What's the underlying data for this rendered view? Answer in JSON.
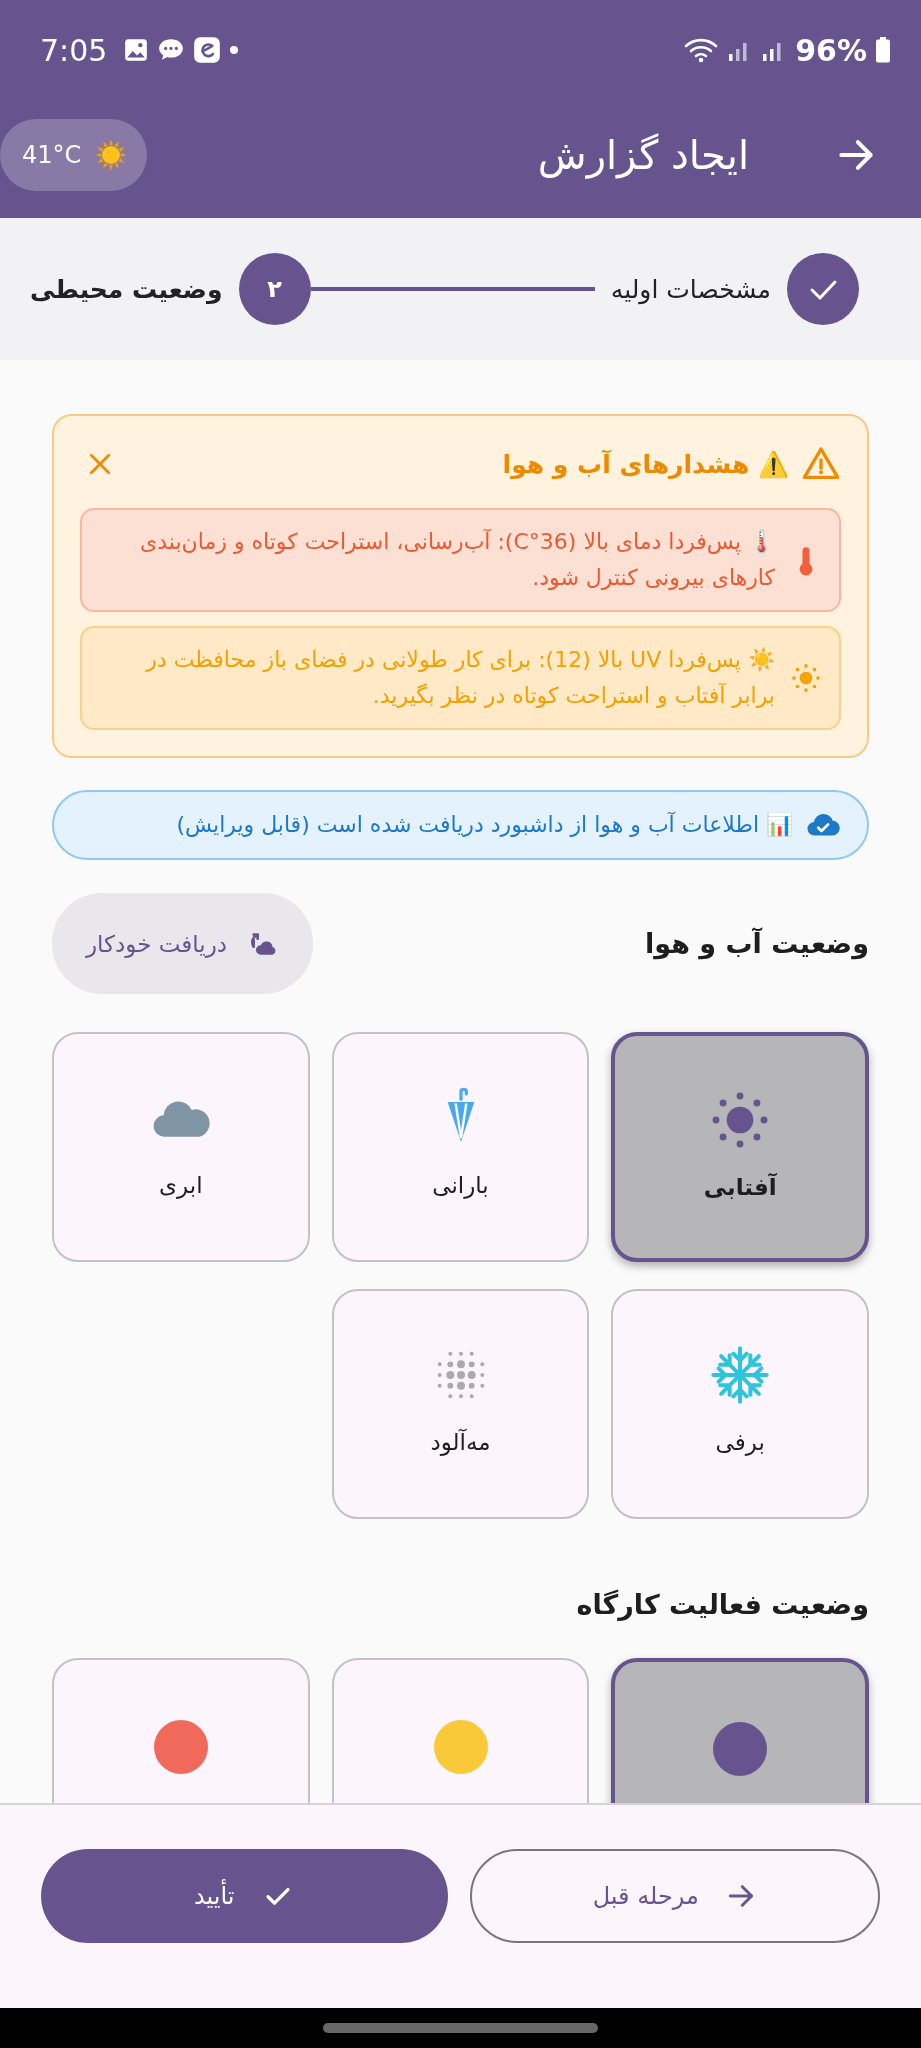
{
  "status_bar": {
    "time": "7:05",
    "battery": "96%"
  },
  "app_bar": {
    "title": "ایجاد گزارش",
    "weather_chip": {
      "temperature": "41°C"
    }
  },
  "stepper": {
    "steps": [
      {
        "label": "مشخصات اولیه",
        "done": true,
        "selected": false
      },
      {
        "label": "وضعیت محیطی",
        "number": "۲",
        "done": false,
        "selected": true
      }
    ]
  },
  "weather_alerts": {
    "title": "⚠️ هشدارهای آب و هوا",
    "alerts": [
      {
        "kind": "heat",
        "text": "🌡️ پس‌فردا دمای بالا (36°C): آب‌رسانی، استراحت کوتاه و زمان‌بندی کارهای بیرونی کنترل شود."
      },
      {
        "kind": "uv",
        "text": "☀️ پس‌فردا UV بالا (12): برای کار طولانی در فضای باز محافظت در برابر آفتاب و استراحت کوتاه در نظر بگیرید."
      }
    ]
  },
  "info_banner": {
    "text": "📊 اطلاعات آب و هوا از داشبورد دریافت شده است (قابل ویرایش)"
  },
  "weather_section": {
    "title": "وضعیت آب و هوا",
    "auto_fetch_button": "دریافت خودکار",
    "options": [
      {
        "kind": "sunny",
        "label": "آفتابی",
        "selected": true
      },
      {
        "kind": "rainy",
        "label": "بارانی",
        "selected": false
      },
      {
        "kind": "cloudy",
        "label": "ابری",
        "selected": false
      },
      {
        "kind": "snowy",
        "label": "برفی",
        "selected": false
      },
      {
        "kind": "foggy",
        "label": "مه‌آلود",
        "selected": false
      }
    ]
  },
  "activity_section": {
    "title": "وضعیت فعالیت کارگاه",
    "options": [
      {
        "selected": true,
        "color": "#67548e"
      },
      {
        "selected": false,
        "color": "#f9c93a"
      },
      {
        "selected": false,
        "color": "#f0695a"
      }
    ]
  },
  "footer": {
    "back_button": "مرحله قبل",
    "confirm_button": "تأیید"
  }
}
